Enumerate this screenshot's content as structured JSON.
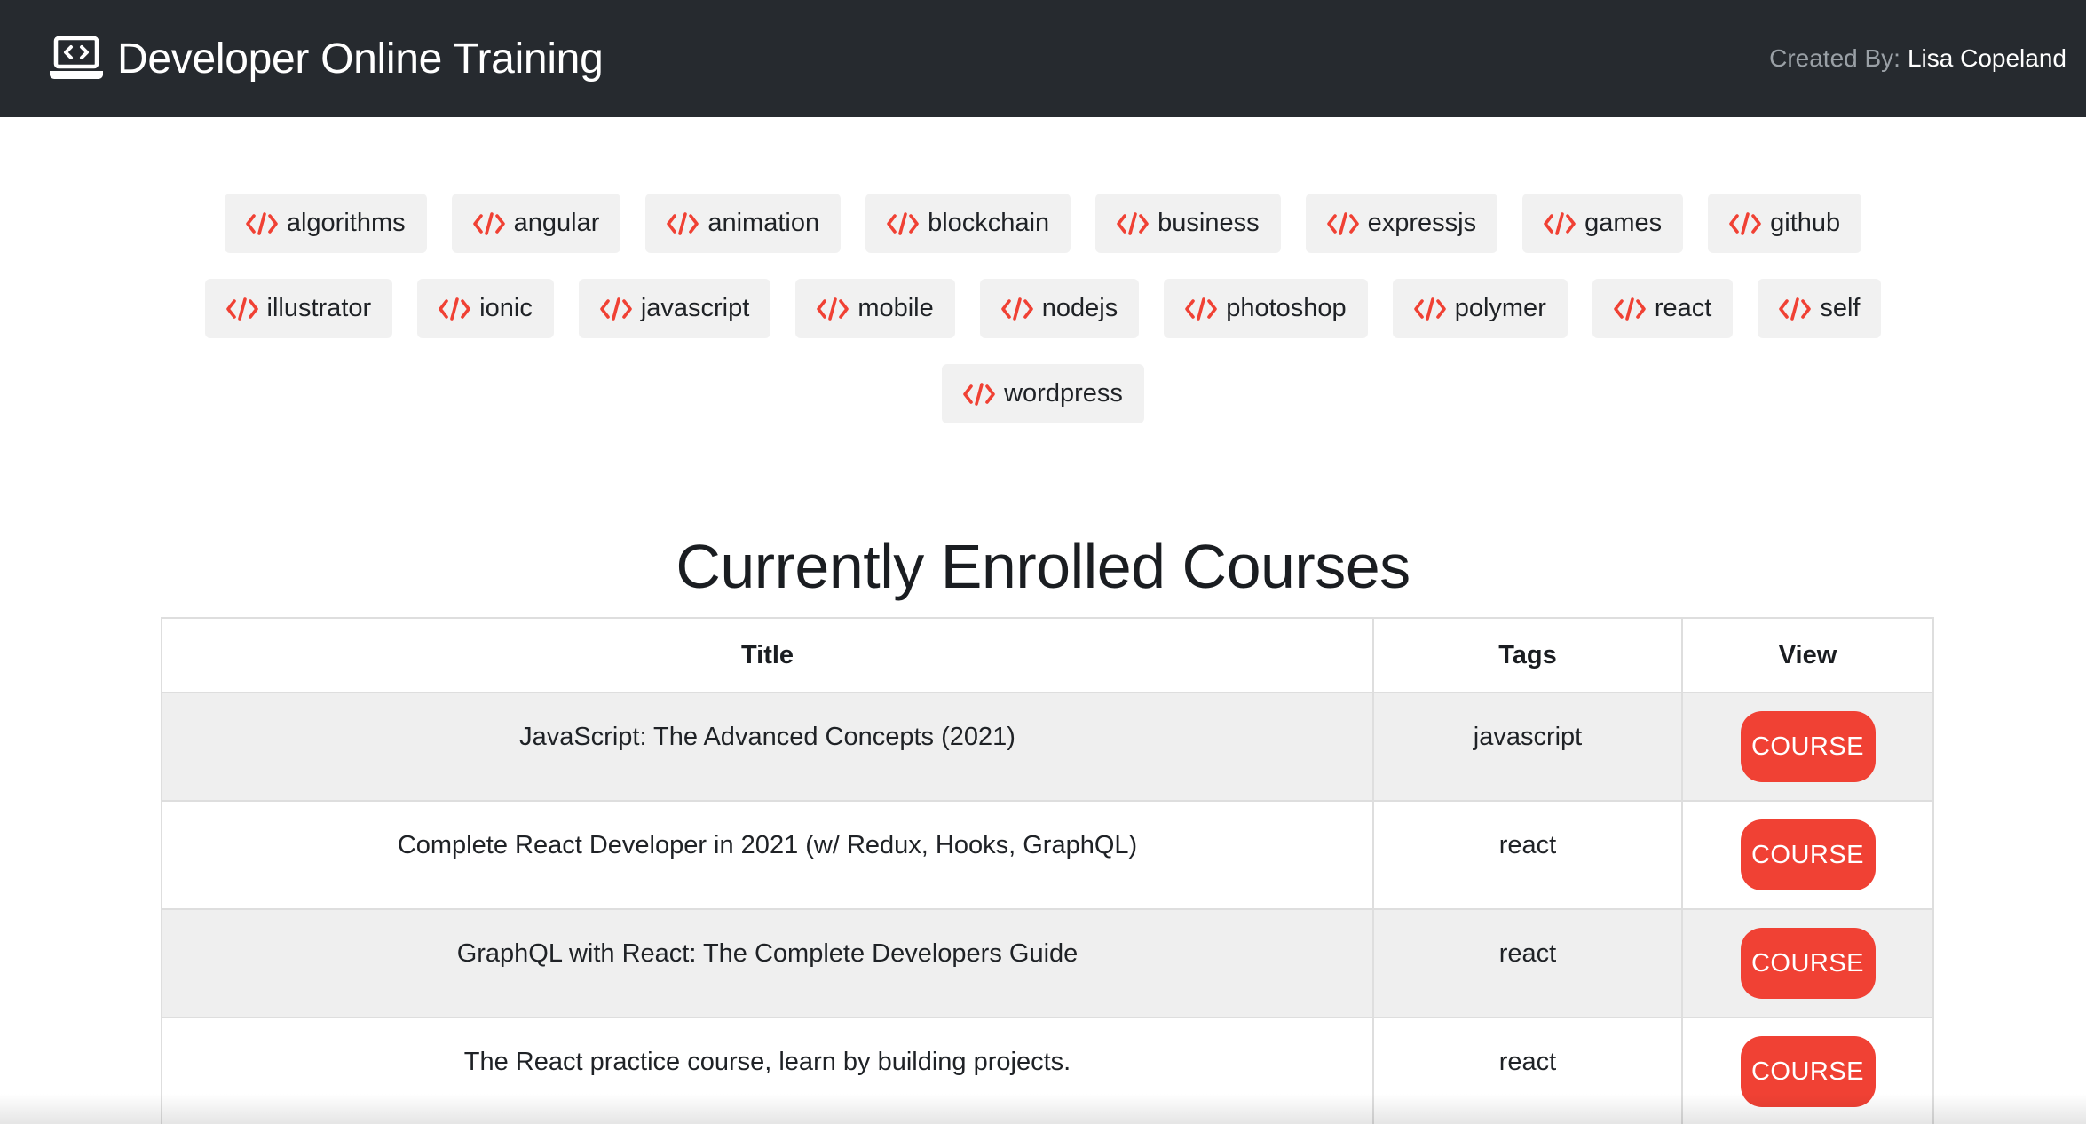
{
  "navbar": {
    "brand_title": "Developer Online Training",
    "brand_icon": "laptop-code-icon",
    "credit_label": "Created By:",
    "credit_name": "Lisa Copeland"
  },
  "tag_icon": "code-icon",
  "accent_color": "#f04134",
  "tag_rows": [
    [
      "algorithms",
      "angular",
      "animation",
      "blockchain",
      "business",
      "expressjs",
      "games",
      "github"
    ],
    [
      "illustrator",
      "ionic",
      "javascript",
      "mobile",
      "nodejs",
      "photoshop",
      "polymer",
      "react",
      "self"
    ],
    [
      "wordpress"
    ]
  ],
  "heading": "Currently Enrolled Courses",
  "table": {
    "headers": [
      "Title",
      "Tags",
      "View"
    ],
    "button_label": "COURSE",
    "rows": [
      {
        "title": "JavaScript: The Advanced Concepts (2021)",
        "tags": "javascript"
      },
      {
        "title": "Complete React Developer in 2021 (w/ Redux, Hooks, GraphQL)",
        "tags": "react"
      },
      {
        "title": "GraphQL with React: The Complete Developers Guide",
        "tags": "react"
      },
      {
        "title": "The React practice course, learn by building projects.",
        "tags": "react"
      }
    ]
  }
}
